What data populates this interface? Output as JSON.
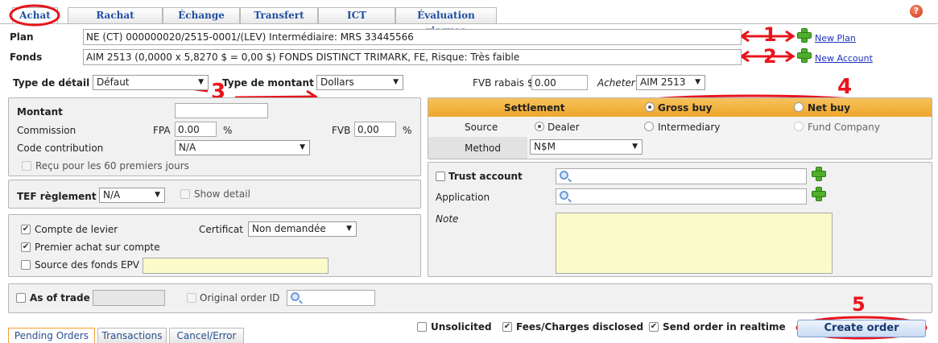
{
  "tabs": [
    "Achat",
    "Rachat",
    "Échange",
    "Transfert",
    "ICT",
    "Évaluation risques"
  ],
  "help_icon": "?",
  "plan": {
    "label": "Plan",
    "value": "NE (CT) 000000020/2515-0001/(LEV) Intermédiaire: MRS 33445566",
    "link": "New Plan"
  },
  "fonds": {
    "label": "Fonds",
    "value": "AIM 2513 (0,0000 x 5,8270 $ = 0,00 $) FONDS DISTINCT TRIMARK, FE, Risque: Très faible",
    "link": "New Account"
  },
  "row3": {
    "type_detail_label": "Type de détail",
    "type_detail_value": "Défaut",
    "type_montant_label": "Type de montant",
    "type_montant_value": "Dollars",
    "fvb_rabais_label": "FVB rabais $",
    "fvb_rabais_value": "0.00",
    "acheter_label": "Acheter",
    "acheter_value": "AIM 2513"
  },
  "montant_panel": {
    "montant_label": "Montant",
    "commission_label": "Commission",
    "fpa_label": "FPA",
    "fpa_value": "0.00",
    "fpa_unit": "%",
    "fvb_label": "FVB",
    "fvb_value": "0,00",
    "fvb_unit": "%",
    "code_label": "Code contribution",
    "code_value": "N/A",
    "recu_label": "Reçu pour les 60 premiers jours"
  },
  "tef_panel": {
    "label": "TEF règlement",
    "value": "N/A",
    "show_detail": "Show detail"
  },
  "compte_panel": {
    "levier_label": "Compte de levier",
    "certificat_label": "Certificat",
    "certificat_value": "Non demandée",
    "premier_label": "Premier achat sur compte",
    "source_label": "Source des fonds EPV"
  },
  "settlement": {
    "title": "Settlement",
    "gross": "Gross buy",
    "net": "Net buy",
    "source_label": "Source",
    "dealer": "Dealer",
    "intermediary": "Intermediary",
    "fund_company": "Fund Company",
    "method_label": "Method",
    "method_value": "N$M"
  },
  "trust_panel": {
    "trust_label": "Trust account",
    "application_label": "Application",
    "note_label": "Note"
  },
  "trade_panel": {
    "as_of_trade": "As of trade",
    "original_order_id": "Original order ID"
  },
  "bottom": {
    "tabs": [
      "Pending Orders",
      "Transactions",
      "Cancel/Error"
    ],
    "unsolicited": "Unsolicited",
    "fees": "Fees/Charges disclosed",
    "realtime": "Send order in realtime",
    "create_order": "Create order"
  },
  "annotations": {
    "n1": "1",
    "n2": "2",
    "n3": "3",
    "n4": "4",
    "n5": "5"
  },
  "colors": {
    "annotation_red": "#e8141c",
    "settlement_orange": "#f3b23c",
    "link_blue": "#1c2fbf",
    "plus_green": "#4fae2c",
    "note_yellow": "#fbfbc9"
  }
}
